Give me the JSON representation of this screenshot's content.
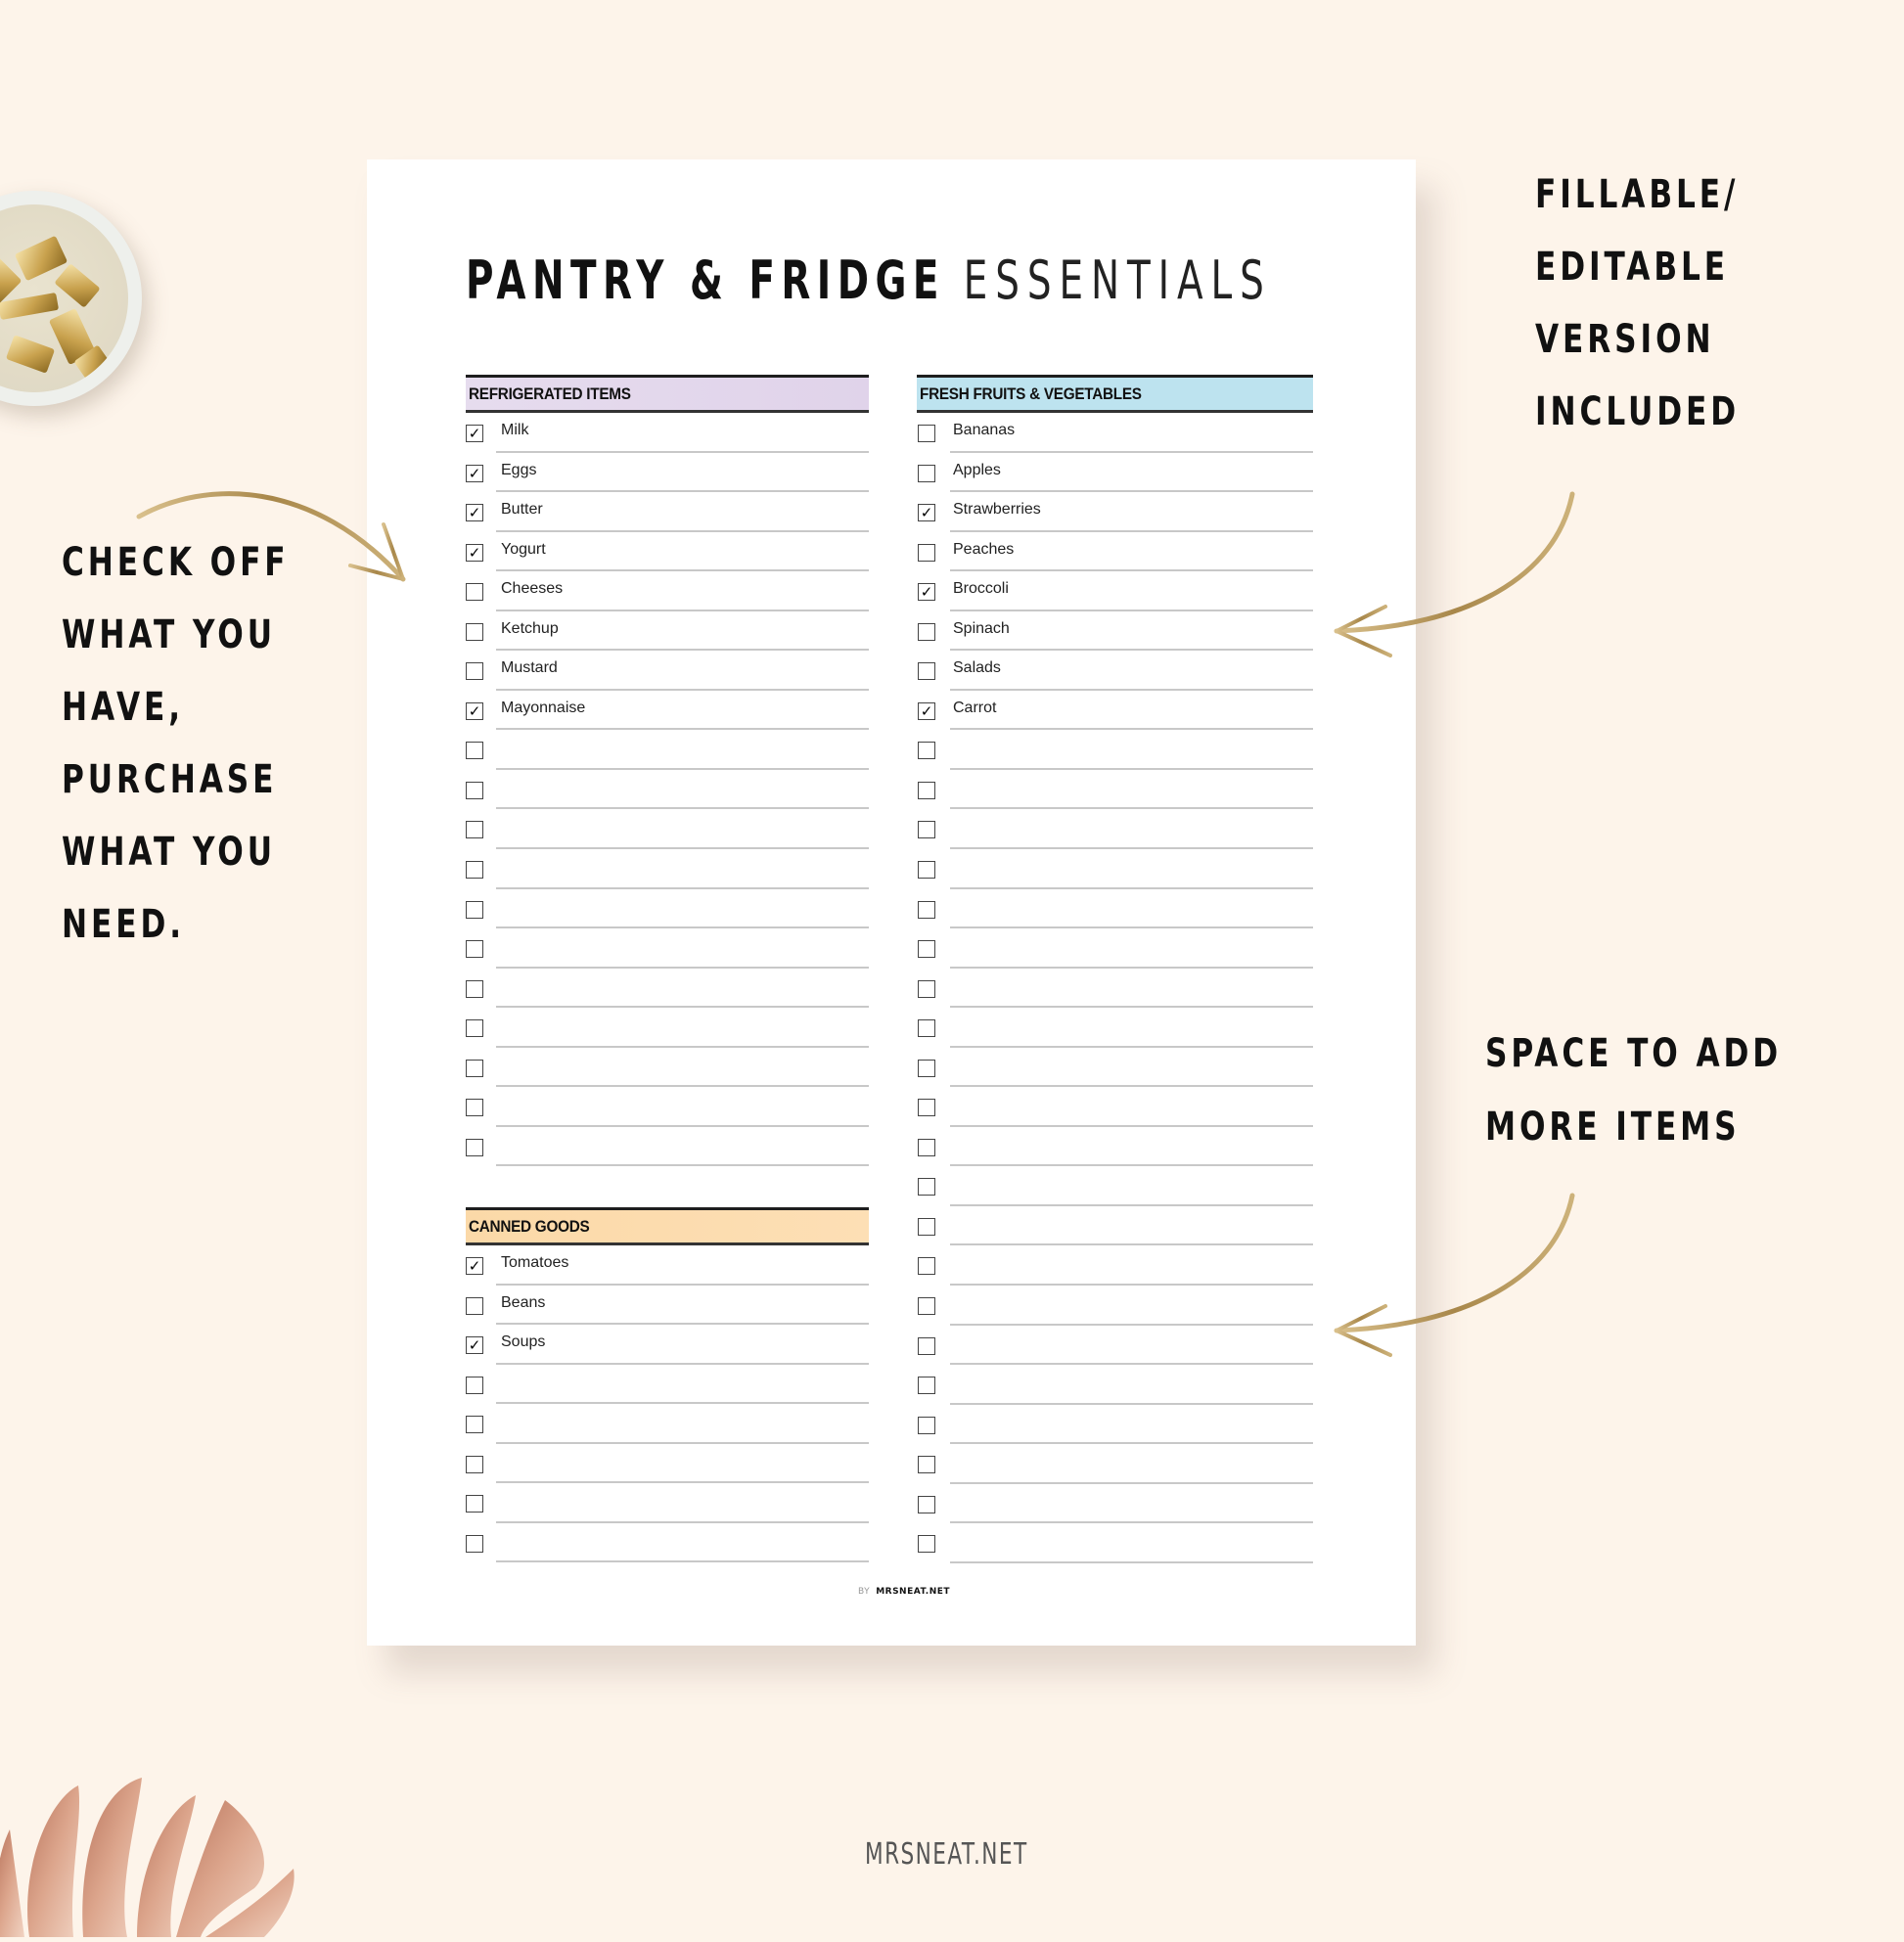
{
  "document": {
    "title_bold": "PANTRY & FRIDGE",
    "title_light": "ESSENTIALS",
    "footer_by": "BY",
    "footer_site": "MRSNEAT.NET",
    "sections": [
      {
        "id": "refrigerated",
        "title": "REFRIGERATED ITEMS",
        "color": "#e4d8ec",
        "items": [
          {
            "label": "Milk",
            "checked": true
          },
          {
            "label": "Eggs",
            "checked": true
          },
          {
            "label": "Butter",
            "checked": true
          },
          {
            "label": "Yogurt",
            "checked": true
          },
          {
            "label": "Cheeses",
            "checked": false
          },
          {
            "label": "Ketchup",
            "checked": false
          },
          {
            "label": "Mustard",
            "checked": false
          },
          {
            "label": "Mayonnaise",
            "checked": true
          },
          {
            "label": "",
            "checked": false
          },
          {
            "label": "",
            "checked": false
          },
          {
            "label": "",
            "checked": false
          },
          {
            "label": "",
            "checked": false
          },
          {
            "label": "",
            "checked": false
          },
          {
            "label": "",
            "checked": false
          },
          {
            "label": "",
            "checked": false
          },
          {
            "label": "",
            "checked": false
          },
          {
            "label": "",
            "checked": false
          },
          {
            "label": "",
            "checked": false
          },
          {
            "label": "",
            "checked": false
          }
        ]
      },
      {
        "id": "fruits",
        "title": "FRESH FRUITS & VEGETABLES",
        "color": "#bde3ef",
        "items": [
          {
            "label": "Bananas",
            "checked": false
          },
          {
            "label": "Apples",
            "checked": false
          },
          {
            "label": "Strawberries",
            "checked": true
          },
          {
            "label": "Peaches",
            "checked": false
          },
          {
            "label": "Broccoli",
            "checked": true
          },
          {
            "label": "Spinach",
            "checked": false
          },
          {
            "label": "Salads",
            "checked": false
          },
          {
            "label": "Carrot",
            "checked": true
          },
          {
            "label": "",
            "checked": false
          },
          {
            "label": "",
            "checked": false
          },
          {
            "label": "",
            "checked": false
          },
          {
            "label": "",
            "checked": false
          },
          {
            "label": "",
            "checked": false
          },
          {
            "label": "",
            "checked": false
          },
          {
            "label": "",
            "checked": false
          },
          {
            "label": "",
            "checked": false
          },
          {
            "label": "",
            "checked": false
          },
          {
            "label": "",
            "checked": false
          },
          {
            "label": "",
            "checked": false
          },
          {
            "label": "",
            "checked": false
          },
          {
            "label": "",
            "checked": false
          },
          {
            "label": "",
            "checked": false
          },
          {
            "label": "",
            "checked": false
          },
          {
            "label": "",
            "checked": false
          },
          {
            "label": "",
            "checked": false
          },
          {
            "label": "",
            "checked": false
          },
          {
            "label": "",
            "checked": false
          },
          {
            "label": "",
            "checked": false
          },
          {
            "label": "",
            "checked": false
          }
        ]
      },
      {
        "id": "canned",
        "title": "CANNED GOODS",
        "color": "#fcdcae",
        "items": [
          {
            "label": "Tomatoes",
            "checked": true
          },
          {
            "label": "Beans",
            "checked": false
          },
          {
            "label": "Soups",
            "checked": true
          },
          {
            "label": "",
            "checked": false
          },
          {
            "label": "",
            "checked": false
          },
          {
            "label": "",
            "checked": false
          },
          {
            "label": "",
            "checked": false
          },
          {
            "label": "",
            "checked": false
          }
        ]
      }
    ]
  },
  "annotations": {
    "left": [
      "CHECK OFF",
      "WHAT YOU",
      "HAVE,",
      "PURCHASE",
      "WHAT YOU",
      "NEED."
    ],
    "right_top": [
      "FILLABLE/",
      "EDITABLE",
      "VERSION",
      "INCLUDED"
    ],
    "right_bottom": [
      "SPACE TO ADD",
      "MORE ITEMS"
    ]
  },
  "brand": "MRSNEAT.NET",
  "colors": {
    "background": "#fdf4ea",
    "arrow_gold": "#b89a5e",
    "check_mark": "✓"
  },
  "icons": {
    "check": "check-icon",
    "arrow": "gold-arrow-icon",
    "bowl": "binder-clips-bowl",
    "leaf": "rose-gold-monstera-leaf"
  }
}
